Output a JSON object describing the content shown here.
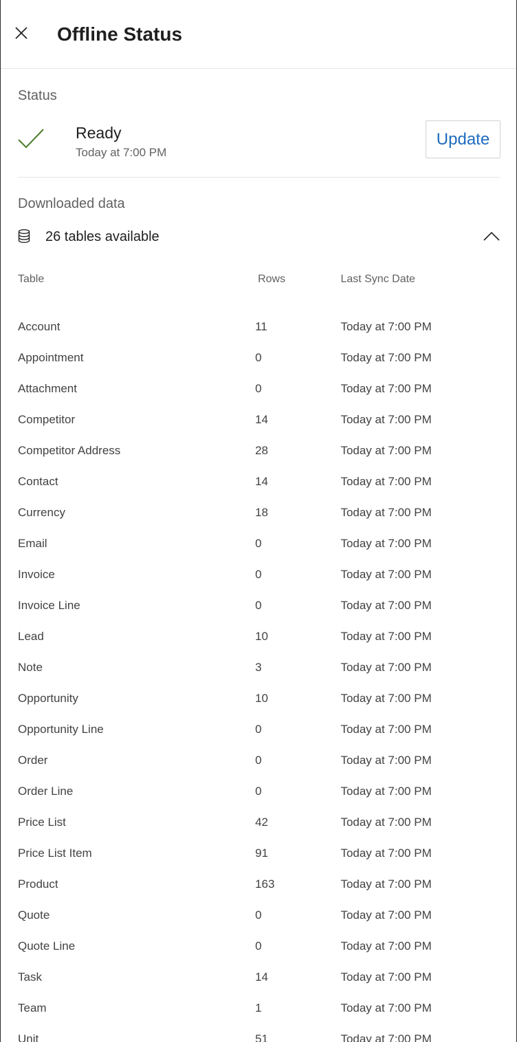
{
  "header": {
    "title": "Offline Status",
    "close_icon": "close-icon"
  },
  "status": {
    "section_label": "Status",
    "state": "Ready",
    "time": "Today at 7:00 PM",
    "update_label": "Update",
    "check_color": "#4a7d2a",
    "accent_color": "#1f6bbf"
  },
  "downloaded": {
    "section_label": "Downloaded data",
    "tables_count": "26 tables available",
    "icon": "database-icon",
    "toggle_icon": "chevron-up-icon"
  },
  "table": {
    "headers": {
      "table": "Table",
      "rows": "Rows",
      "last_sync": "Last Sync Date"
    },
    "rows": [
      {
        "name": "Account",
        "rows": "11",
        "sync": "Today at 7:00 PM"
      },
      {
        "name": "Appointment",
        "rows": "0",
        "sync": "Today at 7:00 PM"
      },
      {
        "name": "Attachment",
        "rows": "0",
        "sync": "Today at 7:00 PM"
      },
      {
        "name": "Competitor",
        "rows": "14",
        "sync": "Today at 7:00 PM"
      },
      {
        "name": "Competitor Address",
        "rows": "28",
        "sync": "Today at 7:00 PM"
      },
      {
        "name": "Contact",
        "rows": "14",
        "sync": "Today at 7:00 PM"
      },
      {
        "name": "Currency",
        "rows": "18",
        "sync": "Today at 7:00 PM"
      },
      {
        "name": "Email",
        "rows": "0",
        "sync": "Today at 7:00 PM"
      },
      {
        "name": "Invoice",
        "rows": "0",
        "sync": "Today at 7:00 PM"
      },
      {
        "name": "Invoice Line",
        "rows": "0",
        "sync": "Today at 7:00 PM"
      },
      {
        "name": "Lead",
        "rows": "10",
        "sync": "Today at 7:00 PM"
      },
      {
        "name": "Note",
        "rows": "3",
        "sync": "Today at 7:00 PM"
      },
      {
        "name": "Opportunity",
        "rows": "10",
        "sync": "Today at 7:00 PM"
      },
      {
        "name": "Opportunity Line",
        "rows": "0",
        "sync": "Today at 7:00 PM"
      },
      {
        "name": "Order",
        "rows": "0",
        "sync": "Today at 7:00 PM"
      },
      {
        "name": "Order Line",
        "rows": "0",
        "sync": "Today at 7:00 PM"
      },
      {
        "name": "Price List",
        "rows": "42",
        "sync": "Today at 7:00 PM"
      },
      {
        "name": "Price List Item",
        "rows": "91",
        "sync": "Today at 7:00 PM"
      },
      {
        "name": "Product",
        "rows": "163",
        "sync": "Today at 7:00 PM"
      },
      {
        "name": "Quote",
        "rows": "0",
        "sync": "Today at 7:00 PM"
      },
      {
        "name": "Quote Line",
        "rows": "0",
        "sync": "Today at 7:00 PM"
      },
      {
        "name": "Task",
        "rows": "14",
        "sync": "Today at 7:00 PM"
      },
      {
        "name": "Team",
        "rows": "1",
        "sync": "Today at 7:00 PM"
      },
      {
        "name": "Unit",
        "rows": "51",
        "sync": "Today at 7:00 PM"
      }
    ]
  }
}
